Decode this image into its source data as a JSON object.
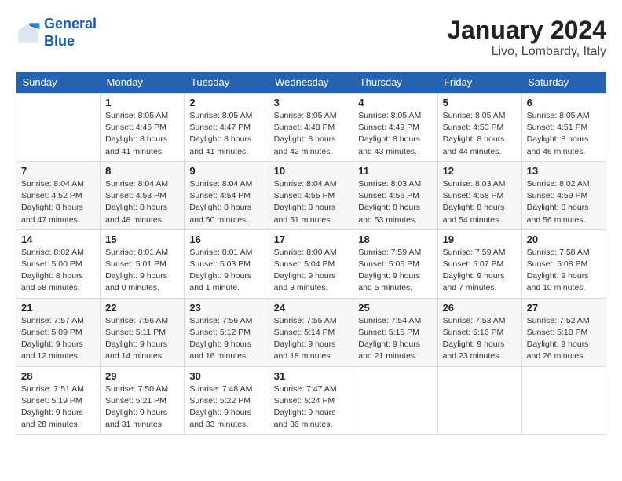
{
  "header": {
    "logo_line1": "General",
    "logo_line2": "Blue",
    "month": "January 2024",
    "location": "Livo, Lombardy, Italy"
  },
  "columns": [
    "Sunday",
    "Monday",
    "Tuesday",
    "Wednesday",
    "Thursday",
    "Friday",
    "Saturday"
  ],
  "weeks": [
    [
      {
        "day": "",
        "info": ""
      },
      {
        "day": "1",
        "info": "Sunrise: 8:05 AM\nSunset: 4:46 PM\nDaylight: 8 hours\nand 41 minutes."
      },
      {
        "day": "2",
        "info": "Sunrise: 8:05 AM\nSunset: 4:47 PM\nDaylight: 8 hours\nand 41 minutes."
      },
      {
        "day": "3",
        "info": "Sunrise: 8:05 AM\nSunset: 4:48 PM\nDaylight: 8 hours\nand 42 minutes."
      },
      {
        "day": "4",
        "info": "Sunrise: 8:05 AM\nSunset: 4:49 PM\nDaylight: 8 hours\nand 43 minutes."
      },
      {
        "day": "5",
        "info": "Sunrise: 8:05 AM\nSunset: 4:50 PM\nDaylight: 8 hours\nand 44 minutes."
      },
      {
        "day": "6",
        "info": "Sunrise: 8:05 AM\nSunset: 4:51 PM\nDaylight: 8 hours\nand 46 minutes."
      }
    ],
    [
      {
        "day": "7",
        "info": "Sunrise: 8:04 AM\nSunset: 4:52 PM\nDaylight: 8 hours\nand 47 minutes."
      },
      {
        "day": "8",
        "info": "Sunrise: 8:04 AM\nSunset: 4:53 PM\nDaylight: 8 hours\nand 48 minutes."
      },
      {
        "day": "9",
        "info": "Sunrise: 8:04 AM\nSunset: 4:54 PM\nDaylight: 8 hours\nand 50 minutes."
      },
      {
        "day": "10",
        "info": "Sunrise: 8:04 AM\nSunset: 4:55 PM\nDaylight: 8 hours\nand 51 minutes."
      },
      {
        "day": "11",
        "info": "Sunrise: 8:03 AM\nSunset: 4:56 PM\nDaylight: 8 hours\nand 53 minutes."
      },
      {
        "day": "12",
        "info": "Sunrise: 8:03 AM\nSunset: 4:58 PM\nDaylight: 8 hours\nand 54 minutes."
      },
      {
        "day": "13",
        "info": "Sunrise: 8:02 AM\nSunset: 4:59 PM\nDaylight: 8 hours\nand 56 minutes."
      }
    ],
    [
      {
        "day": "14",
        "info": "Sunrise: 8:02 AM\nSunset: 5:00 PM\nDaylight: 8 hours\nand 58 minutes."
      },
      {
        "day": "15",
        "info": "Sunrise: 8:01 AM\nSunset: 5:01 PM\nDaylight: 9 hours\nand 0 minutes."
      },
      {
        "day": "16",
        "info": "Sunrise: 8:01 AM\nSunset: 5:03 PM\nDaylight: 9 hours\nand 1 minute."
      },
      {
        "day": "17",
        "info": "Sunrise: 8:00 AM\nSunset: 5:04 PM\nDaylight: 9 hours\nand 3 minutes."
      },
      {
        "day": "18",
        "info": "Sunrise: 7:59 AM\nSunset: 5:05 PM\nDaylight: 9 hours\nand 5 minutes."
      },
      {
        "day": "19",
        "info": "Sunrise: 7:59 AM\nSunset: 5:07 PM\nDaylight: 9 hours\nand 7 minutes."
      },
      {
        "day": "20",
        "info": "Sunrise: 7:58 AM\nSunset: 5:08 PM\nDaylight: 9 hours\nand 10 minutes."
      }
    ],
    [
      {
        "day": "21",
        "info": "Sunrise: 7:57 AM\nSunset: 5:09 PM\nDaylight: 9 hours\nand 12 minutes."
      },
      {
        "day": "22",
        "info": "Sunrise: 7:56 AM\nSunset: 5:11 PM\nDaylight: 9 hours\nand 14 minutes."
      },
      {
        "day": "23",
        "info": "Sunrise: 7:56 AM\nSunset: 5:12 PM\nDaylight: 9 hours\nand 16 minutes."
      },
      {
        "day": "24",
        "info": "Sunrise: 7:55 AM\nSunset: 5:14 PM\nDaylight: 9 hours\nand 18 minutes."
      },
      {
        "day": "25",
        "info": "Sunrise: 7:54 AM\nSunset: 5:15 PM\nDaylight: 9 hours\nand 21 minutes."
      },
      {
        "day": "26",
        "info": "Sunrise: 7:53 AM\nSunset: 5:16 PM\nDaylight: 9 hours\nand 23 minutes."
      },
      {
        "day": "27",
        "info": "Sunrise: 7:52 AM\nSunset: 5:18 PM\nDaylight: 9 hours\nand 26 minutes."
      }
    ],
    [
      {
        "day": "28",
        "info": "Sunrise: 7:51 AM\nSunset: 5:19 PM\nDaylight: 9 hours\nand 28 minutes."
      },
      {
        "day": "29",
        "info": "Sunrise: 7:50 AM\nSunset: 5:21 PM\nDaylight: 9 hours\nand 31 minutes."
      },
      {
        "day": "30",
        "info": "Sunrise: 7:48 AM\nSunset: 5:22 PM\nDaylight: 9 hours\nand 33 minutes."
      },
      {
        "day": "31",
        "info": "Sunrise: 7:47 AM\nSunset: 5:24 PM\nDaylight: 9 hours\nand 36 minutes."
      },
      {
        "day": "",
        "info": ""
      },
      {
        "day": "",
        "info": ""
      },
      {
        "day": "",
        "info": ""
      }
    ]
  ]
}
